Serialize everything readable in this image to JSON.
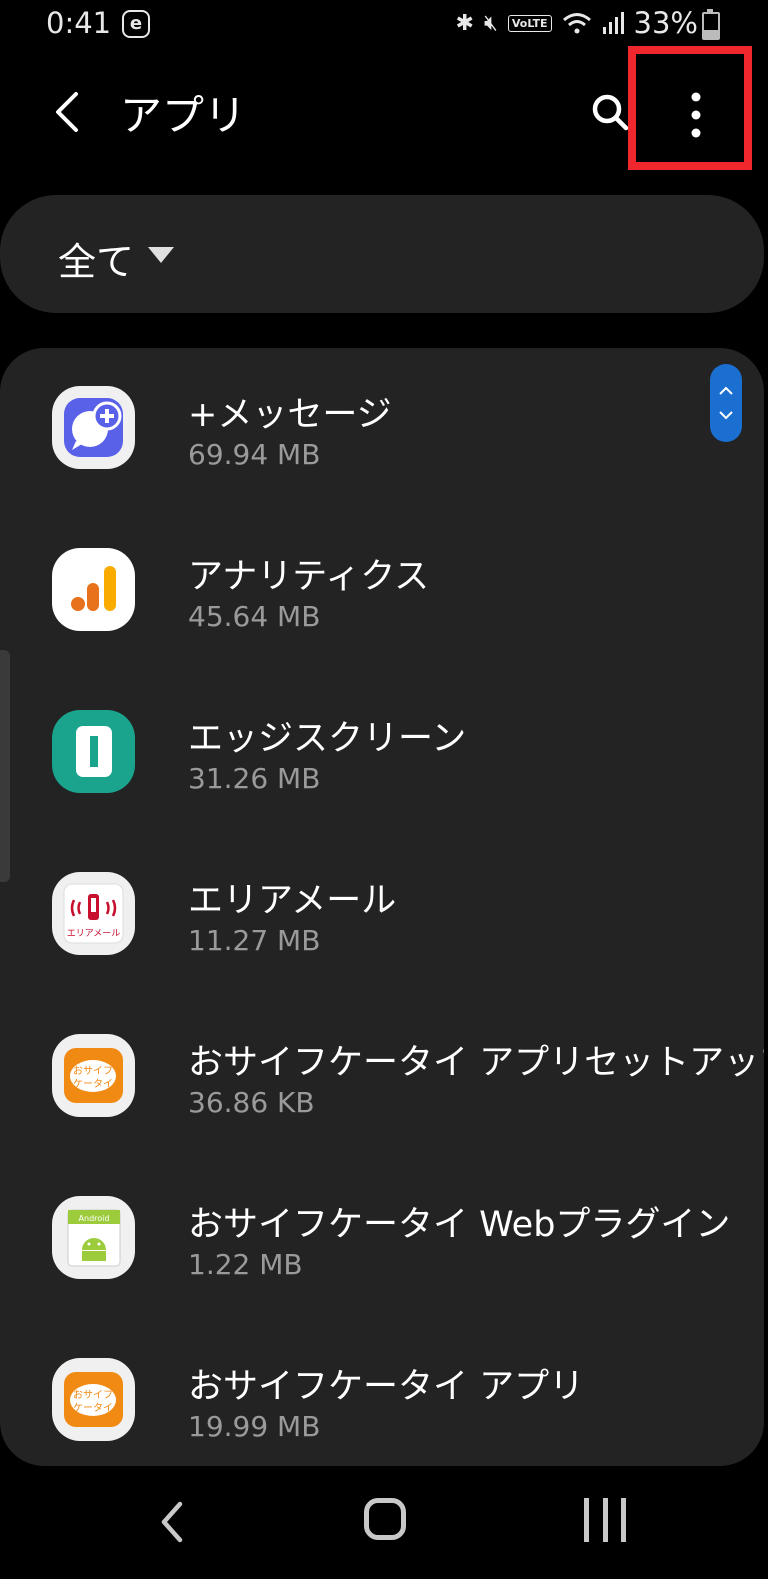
{
  "status_bar": {
    "time": "0:41",
    "carrier_icon_text": "e",
    "volte": "VoLTE",
    "battery_percent": "33%",
    "icons": [
      "bluetooth-icon",
      "mute-icon",
      "volte-icon",
      "wifi-icon",
      "signal-icon",
      "battery-charging-icon"
    ]
  },
  "app_bar": {
    "title": "アプリ",
    "icons": [
      "back-icon",
      "search-icon",
      "more-options-icon"
    ]
  },
  "filter": {
    "label": "全て"
  },
  "apps": [
    {
      "name": "+メッセージ",
      "size": "69.94 MB",
      "icon": "plus-message-icon"
    },
    {
      "name": "アナリティクス",
      "size": "45.64 MB",
      "icon": "analytics-icon"
    },
    {
      "name": "エッジスクリーン",
      "size": "31.26 MB",
      "icon": "edge-screen-icon"
    },
    {
      "name": "エリアメール",
      "size": "11.27 MB",
      "icon": "area-mail-icon"
    },
    {
      "name": "おサイフケータイ アプリセットアップ",
      "size": "36.86 KB",
      "icon": "osaifu-setup-icon"
    },
    {
      "name": "おサイフケータイ Webプラグイン",
      "size": "1.22 MB",
      "icon": "osaifu-web-plugin-icon"
    },
    {
      "name": "おサイフケータイ アプリ",
      "size": "19.99 MB",
      "icon": "osaifu-app-icon"
    }
  ],
  "area_mail_icon_text": "エリアメール",
  "osaifu_icon_text_top": "おサイフ",
  "osaifu_icon_text_bottom": "ケータイ",
  "android_icon_text": "Android",
  "colors": {
    "background": "#000000",
    "card": "#232323",
    "highlight": "#f0282d",
    "scroll_accent": "#1b6fd1"
  }
}
